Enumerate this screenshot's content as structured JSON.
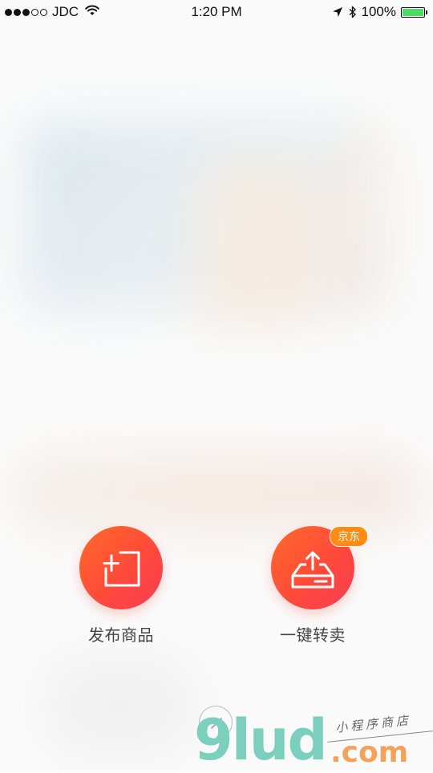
{
  "status_bar": {
    "carrier": "JDC",
    "time": "1:20 PM",
    "battery_percent": "100%",
    "signal_bars_filled": 3,
    "signal_bars_total": 5,
    "battery_level": 1.0,
    "icons": [
      "signal-dots-icon",
      "wifi-icon",
      "location-arrow-icon",
      "bluetooth-icon",
      "battery-icon"
    ]
  },
  "actions": {
    "publish": {
      "label": "发布商品",
      "icon": "add-square-icon"
    },
    "resell": {
      "label": "一键转卖",
      "icon": "upload-tray-icon",
      "badge": "京东"
    }
  },
  "close": {
    "icon": "close-icon"
  },
  "watermark": {
    "main": "9lud",
    "domain": ".com",
    "tagline": "小程序商店"
  },
  "colors": {
    "accent_start": "#ff6a2a",
    "accent_end": "#f73c55",
    "badge": "#ff8a14",
    "battery": "#4cd964"
  }
}
